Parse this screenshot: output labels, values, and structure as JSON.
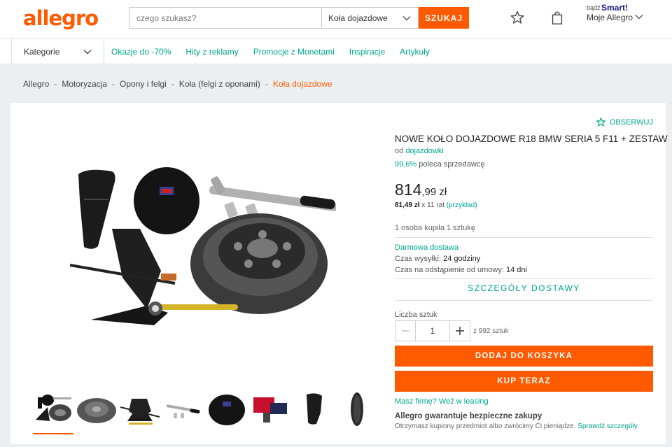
{
  "header": {
    "logo": "allegro",
    "search_placeholder": "czego szukasz?",
    "category_selected": "Koła dojazdowe",
    "search_button": "SZUKAJ",
    "smart_prefix": "bądź",
    "smart_label": "Smart!",
    "account_label": "Moje Allegro"
  },
  "nav": {
    "categories_label": "Kategorie",
    "links": [
      "Okazje do -70%",
      "Hity z reklamy",
      "Promocje z Monetami",
      "Inspiracje",
      "Artykuły"
    ]
  },
  "breadcrumb": {
    "items": [
      "Allegro",
      "Motoryzacja",
      "Opony i felgi",
      "Koła (felgi z oponami)"
    ],
    "current": "Koła dojazdowe",
    "separator": "-"
  },
  "product": {
    "observe_label": "OBSERWUJ",
    "title": "NOWE KOŁO DOJAZDOWE R18 BMW SERIA 5 F11 + ZESTAW",
    "seller_prefix": "od",
    "seller_name": "dojazdowki",
    "rating_pct": "99,6%",
    "rating_text": "poleca sprzedawcę",
    "price_main": "814",
    "price_cents": ",99 zł",
    "installment_amount": "81,49 zł",
    "installment_text": "x 11 rat",
    "installment_link": "(przykład)",
    "bought_text": "1 osoba kupiła 1 sztukę",
    "free_delivery": "Darmowa dostawa",
    "ship_time_label": "Czas wysyłki:",
    "ship_time_value": "24 godziny",
    "return_label": "Czas na odstąpienie od umowy:",
    "return_value": "14 dni",
    "delivery_details": "SZCZEGÓŁY DOSTAWY",
    "qty_label": "Liczba sztuk",
    "qty_value": "1",
    "qty_available": "z 992 sztuk",
    "add_to_cart": "DODAJ DO KOSZYKA",
    "buy_now": "KUP TERAZ",
    "leasing": "Masz firmę? Weź w leasing",
    "guarantee_title": "Allegro gwarantuje bezpieczne zakupy",
    "guarantee_text": "Otrzymasz kupiony przedmiot albo zwrócimy Ci pieniądze.",
    "guarantee_link": "Sprawdź szczegóły."
  },
  "colors": {
    "accent": "#ff5a00",
    "link": "#00a790"
  }
}
